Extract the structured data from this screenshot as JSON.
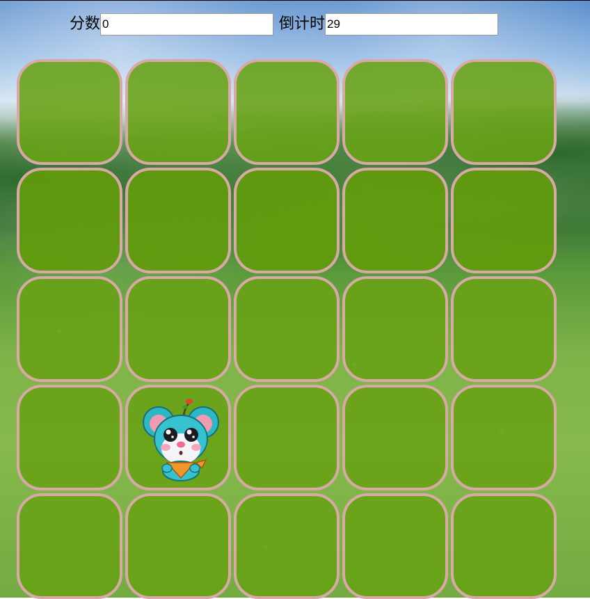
{
  "score": {
    "label": "分数",
    "value": "0"
  },
  "countdown": {
    "label": "倒计时",
    "value": "29"
  },
  "board": {
    "rows": 5,
    "cols": 5,
    "mouse_position": {
      "row": 3,
      "col": 1
    },
    "hole_color": "#68a214",
    "hole_border_color": "#d8a9a6"
  }
}
